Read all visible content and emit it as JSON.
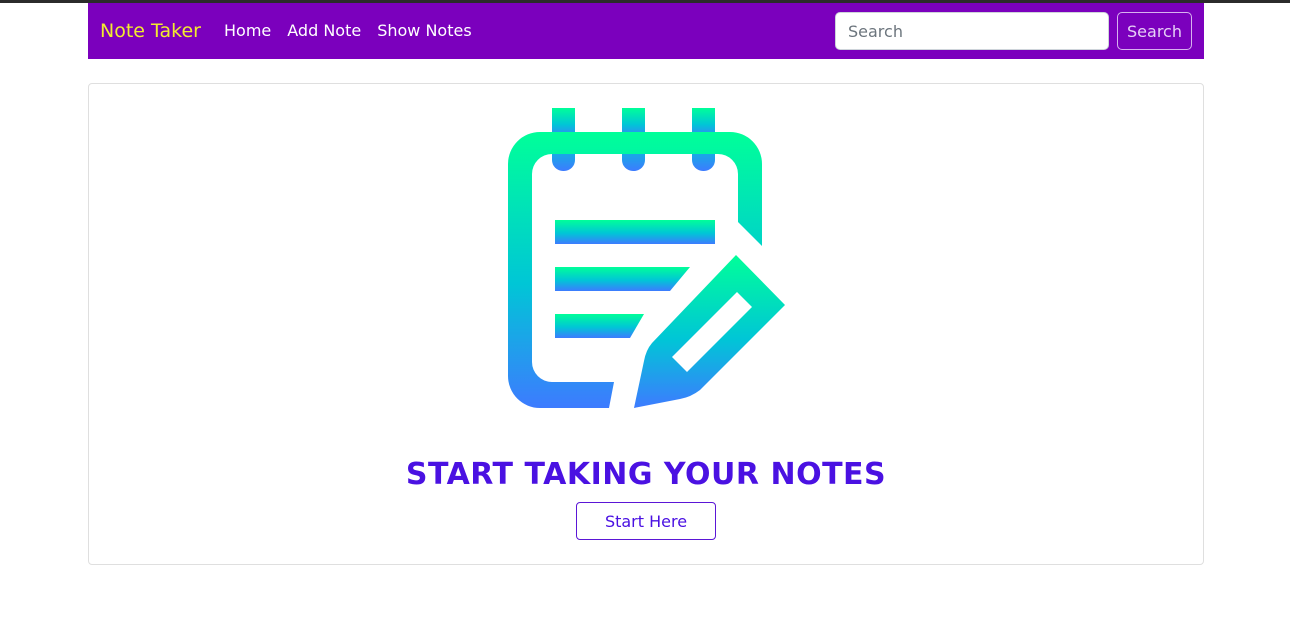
{
  "navbar": {
    "brand": "Note Taker",
    "links": [
      {
        "label": "Home"
      },
      {
        "label": "Add Note"
      },
      {
        "label": "Show Notes"
      }
    ],
    "search": {
      "placeholder": "Search",
      "value": "",
      "button_label": "Search"
    }
  },
  "hero": {
    "icon": "notepad-pencil-icon",
    "title": "START TAKING YOUR NOTES",
    "button_label": "Start Here"
  },
  "colors": {
    "navbar_bg": "#7b00bd",
    "brand_color": "#f2ec2e",
    "accent": "#4a11e2",
    "icon_gradient_top": "#00ff99",
    "icon_gradient_bottom": "#3d7bff"
  }
}
